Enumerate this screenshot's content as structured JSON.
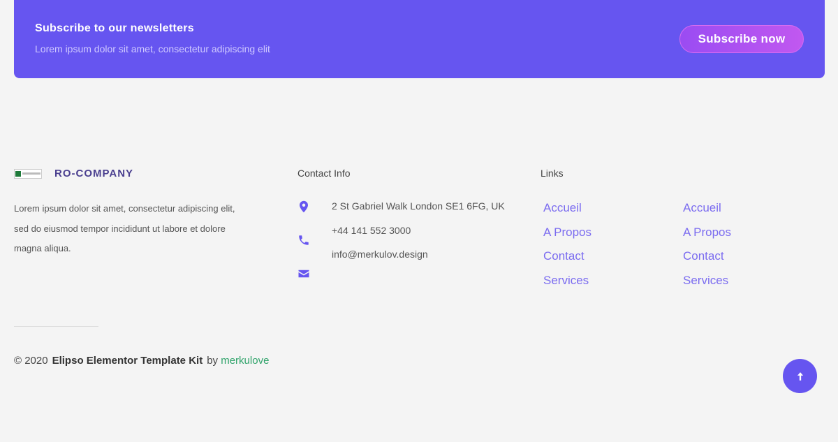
{
  "newsletter": {
    "title": "Subscribe to our newsletters",
    "subtitle": "Lorem ipsum dolor sit amet, consectetur adipiscing elit",
    "button_label": "Subscribe now"
  },
  "brand": {
    "name": "RO-COMPANY",
    "logo_text": "Company"
  },
  "about": {
    "text": "Lorem ipsum dolor sit amet, consectetur adipiscing elit, sed do eiusmod tempor incididunt ut labore et dolore magna aliqua."
  },
  "contact": {
    "title": "Contact Info",
    "address": "2 St Gabriel Walk London SE1 6FG, UK",
    "phone": "+44 141 552 3000",
    "email": "info@merkulov.design",
    "icons": [
      "map-pin-icon",
      "phone-icon",
      "envelope-icon"
    ]
  },
  "links": {
    "title": "Links",
    "column_1": [
      "Accueil",
      "A Propos",
      "Contact",
      "Services"
    ],
    "column_2": [
      "Accueil",
      "A Propos",
      "Contact",
      "Services"
    ]
  },
  "footer": {
    "copyright": "© 2020",
    "kit_name": "Elipso Elementor Template Kit",
    "by_label": "by",
    "author": "merkulove"
  },
  "colors": {
    "accent": "#6655f0",
    "link": "#7b6cf0",
    "author_link": "#2fa36a",
    "background": "#f4f4f4"
  }
}
